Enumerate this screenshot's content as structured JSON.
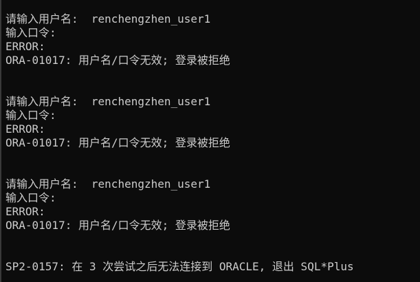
{
  "attempts": [
    {
      "prompt_user": "请输入用户名:  ",
      "username": "renchengzhen_user1",
      "prompt_password": "输入口令:",
      "error": "ERROR:",
      "message": "ORA-01017: 用户名/口令无效; 登录被拒绝"
    },
    {
      "prompt_user": "请输入用户名:  ",
      "username": "renchengzhen_user1",
      "prompt_password": "输入口令:",
      "error": "ERROR:",
      "message": "ORA-01017: 用户名/口令无效; 登录被拒绝"
    },
    {
      "prompt_user": "请输入用户名:  ",
      "username": "renchengzhen_user1",
      "prompt_password": "输入口令:",
      "error": "ERROR:",
      "message": "ORA-01017: 用户名/口令无效; 登录被拒绝"
    }
  ],
  "final_message": "SP2-0157: 在 3 次尝试之后无法连接到 ORACLE, 退出 SQL*Plus"
}
